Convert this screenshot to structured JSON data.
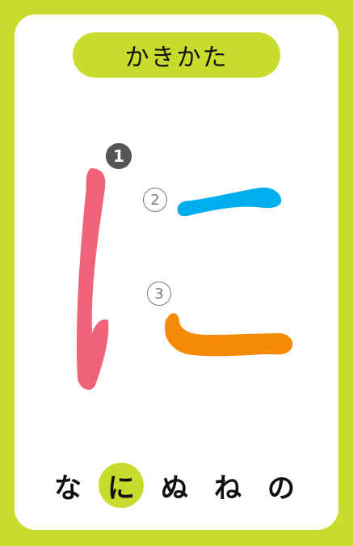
{
  "title": "かきかた",
  "stroke_numbers": [
    "❶",
    "②",
    "③"
  ],
  "stroke_colors": {
    "stroke1": "#f06277",
    "stroke2": "#00aeef",
    "stroke3": "#f58a07"
  },
  "kana_row": [
    "な",
    "に",
    "ぬ",
    "ね",
    "の"
  ],
  "current_kana": "に",
  "accent_color": "#c8dc2e"
}
